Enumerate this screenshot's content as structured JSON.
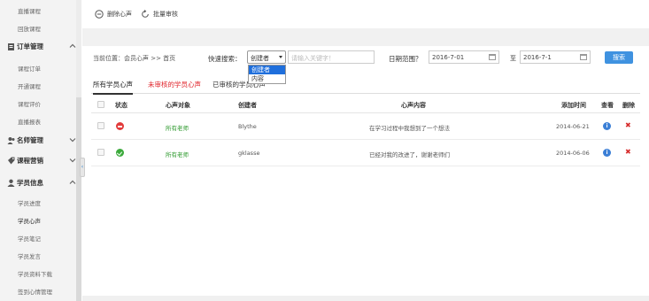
{
  "sidebar": {
    "top_items": [
      "直播课程",
      "回放课程"
    ],
    "groups": [
      {
        "label": "订单管理",
        "items": [
          "课程订单",
          "开通课程",
          "课程评价",
          "直播报表"
        ]
      },
      {
        "label": "名师管理",
        "items": []
      },
      {
        "label": "课程营销",
        "items": []
      },
      {
        "label": "学员信息",
        "items": [
          "学员进度",
          "学员心声",
          "学员笔记",
          "学员发言",
          "学员资料下载",
          "签到心情管理"
        ]
      }
    ]
  },
  "toolbar": {
    "delete_label": "删除心声",
    "batch_label": "批量审核"
  },
  "filter": {
    "breadcrumb": "当前位置：会员心声 >> 首页",
    "quick_search_label": "快速搜索：",
    "select_value": "创建者",
    "keyword_placeholder": "请输入关键字！",
    "date_label": "日期范围？",
    "date_from": "2016-7-01",
    "to_label": "至",
    "date_to": "2016-7-1",
    "search_label": "搜索",
    "dropdown_options": [
      "创建者",
      "内容"
    ]
  },
  "tabs": [
    "所有学员心声",
    "未审核的学员心声",
    "已审核的学员心声"
  ],
  "table": {
    "headers": [
      "状态",
      "心声对象",
      "创建者",
      "心声内容",
      "添加时间",
      "查看",
      "删除"
    ],
    "rows": [
      {
        "status": "red",
        "target": "所有老师",
        "creator": "Blythe",
        "content": "在学习过程中我想到了一个想法",
        "time": "2014-06-21"
      },
      {
        "status": "green",
        "target": "所有老师",
        "creator": "gklasse",
        "content": "已经对我的改进了，谢谢老师们",
        "time": "2014-06-06"
      }
    ]
  },
  "colors": {
    "accent": "#3f92e0",
    "tab_red": "#e0242b",
    "target_green": "#2e9a2e"
  }
}
